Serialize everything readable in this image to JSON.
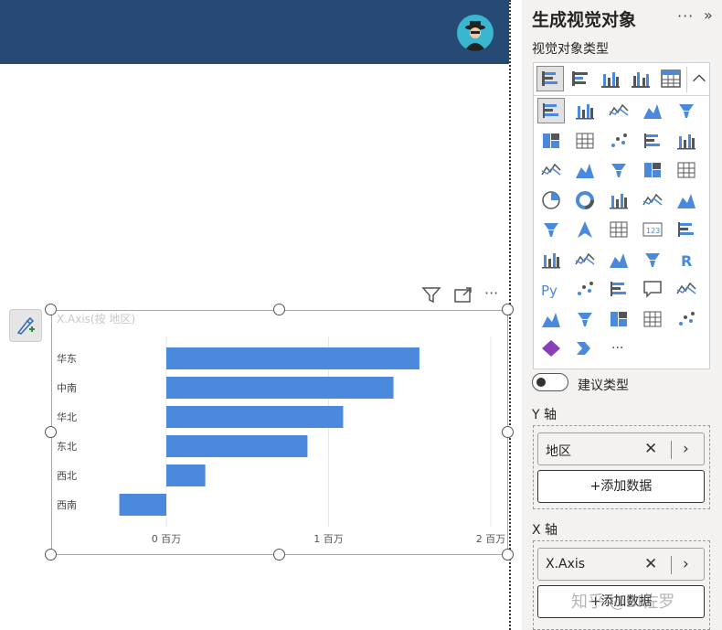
{
  "canvas": {
    "visual_title": "X.Axis(按 地区)"
  },
  "chart_data": {
    "type": "bar",
    "orientation": "horizontal",
    "title": "X.Axis(按 地区)",
    "categories": [
      "华东",
      "中南",
      "华北",
      "东北",
      "西北",
      "西南"
    ],
    "values": [
      1560000,
      1400000,
      1090000,
      870000,
      240000,
      -290000
    ],
    "xlim": [
      -300000,
      2000000
    ],
    "ticks": [
      0,
      1000000,
      2000000
    ],
    "tick_labels": [
      "0 百万",
      "1 百万",
      "2 百万"
    ],
    "bar_color": "#4a89dc",
    "grid": true
  },
  "panel": {
    "title": "生成视觉对象",
    "more": "···",
    "collapse": "»",
    "visual_types_label": "视觉对象类型",
    "suggest_toggle_label": "建议类型",
    "y_axis": {
      "label": "Y 轴",
      "field": "地区",
      "add_label": "+添加数据"
    },
    "x_axis": {
      "label": "X 轴",
      "field": "X.Axis",
      "add_label": "+添加数据"
    }
  },
  "icons": {
    "toolbar": [
      "filter-icon",
      "focus-mode-icon",
      "more-options-icon"
    ],
    "format": "format-brush-icon",
    "avatar": "user-avatar"
  },
  "watermark": "知乎 @BI佐罗"
}
